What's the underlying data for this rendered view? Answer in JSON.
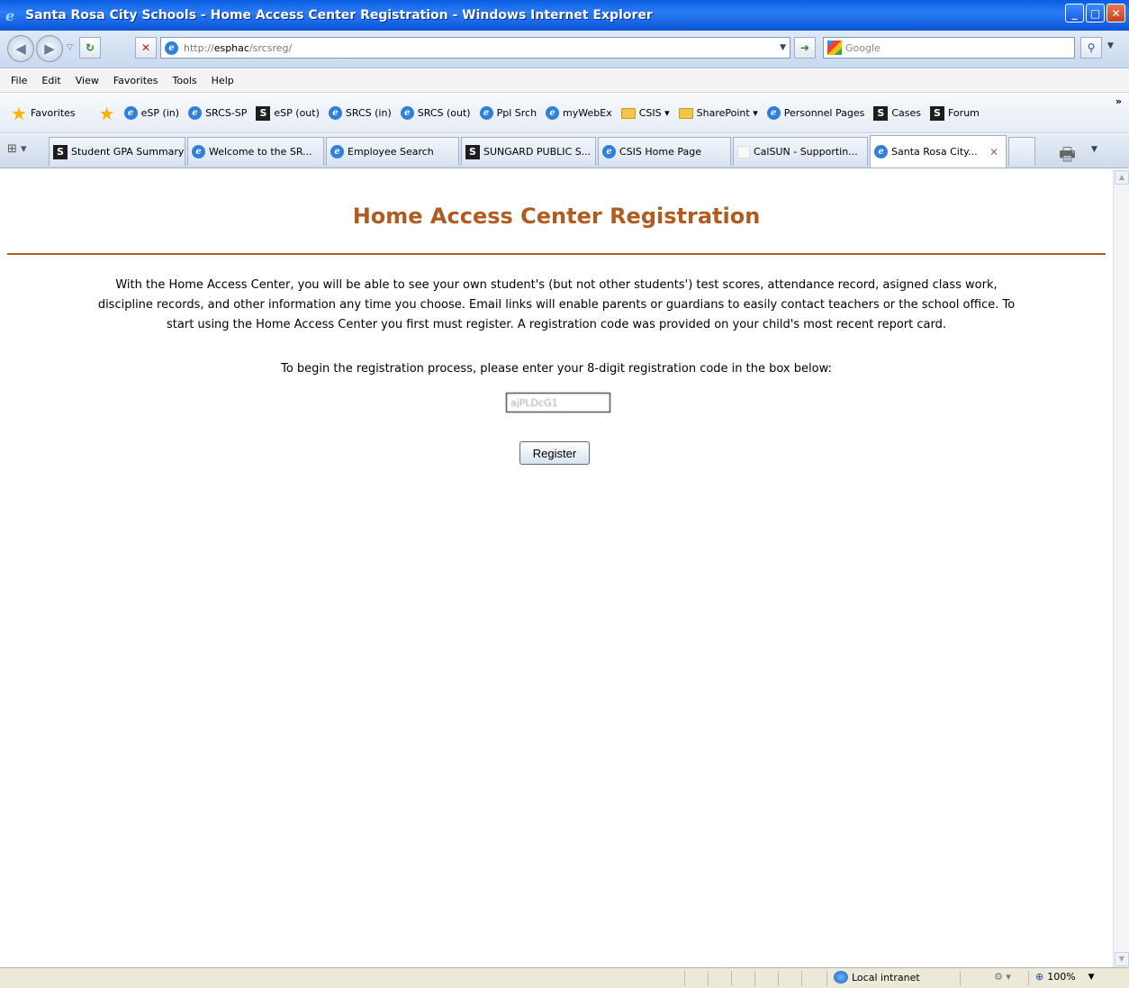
{
  "window": {
    "title": "Santa Rosa City Schools - Home Access Center Registration - Windows Internet Explorer"
  },
  "address": {
    "url_prefix": "http://",
    "url_host": "esphac",
    "url_path": "/srcsreg/",
    "search_placeholder": "Google"
  },
  "menu": [
    "File",
    "Edit",
    "View",
    "Favorites",
    "Tools",
    "Help"
  ],
  "favorites": {
    "label": "Favorites",
    "items": [
      {
        "icon": "ie-icon",
        "label": "eSP (in)"
      },
      {
        "icon": "ie-icon",
        "label": "SRCS-SP"
      },
      {
        "icon": "s-icon",
        "label": "eSP (out)"
      },
      {
        "icon": "ie-icon",
        "label": "SRCS (in)"
      },
      {
        "icon": "ie-icon",
        "label": "SRCS (out)"
      },
      {
        "icon": "ie-icon",
        "label": "Ppl Srch"
      },
      {
        "icon": "ie-icon",
        "label": "myWebEx"
      },
      {
        "icon": "folder-icon",
        "label": "CSIS ▾"
      },
      {
        "icon": "folder-icon",
        "label": "SharePoint ▾"
      },
      {
        "icon": "ie-icon",
        "label": "Personnel Pages"
      },
      {
        "icon": "s-icon",
        "label": "Cases"
      },
      {
        "icon": "s-icon",
        "label": "Forum"
      }
    ],
    "overflow": "»"
  },
  "tabs": [
    {
      "icon": "s-icon",
      "label": "Student GPA Summary"
    },
    {
      "icon": "ie-icon",
      "label": "Welcome to the SR..."
    },
    {
      "icon": "ie-icon",
      "label": "Employee Search"
    },
    {
      "icon": "s-icon",
      "label": "SUNGARD PUBLIC S..."
    },
    {
      "icon": "ie-icon",
      "label": "CSIS Home Page"
    },
    {
      "icon": "blank-icon",
      "label": "CalSUN - Supportin..."
    },
    {
      "icon": "ie-icon",
      "label": "Santa Rosa City..."
    }
  ],
  "page": {
    "heading": "Home Access Center Registration",
    "intro": "With the Home Access Center, you will be able to see your own student's (but not other students') test scores, attendance record, asigned class work, discipline records, and other information any time you choose.  Email links will enable parents or guardians to easily contact teachers or the school office.  To start using the Home Access Center you first must register. A registration code was provided on your child's most recent report card.",
    "prompt": "To begin the registration process, please enter your 8-digit registration code in the box below:",
    "code_value": "ajPLDcG1",
    "register_label": "Register"
  },
  "status": {
    "zone": "Local intranet",
    "zoom": "100%"
  },
  "colors": {
    "heading": "#b25b1e",
    "titlebar": "#0a5de0"
  }
}
